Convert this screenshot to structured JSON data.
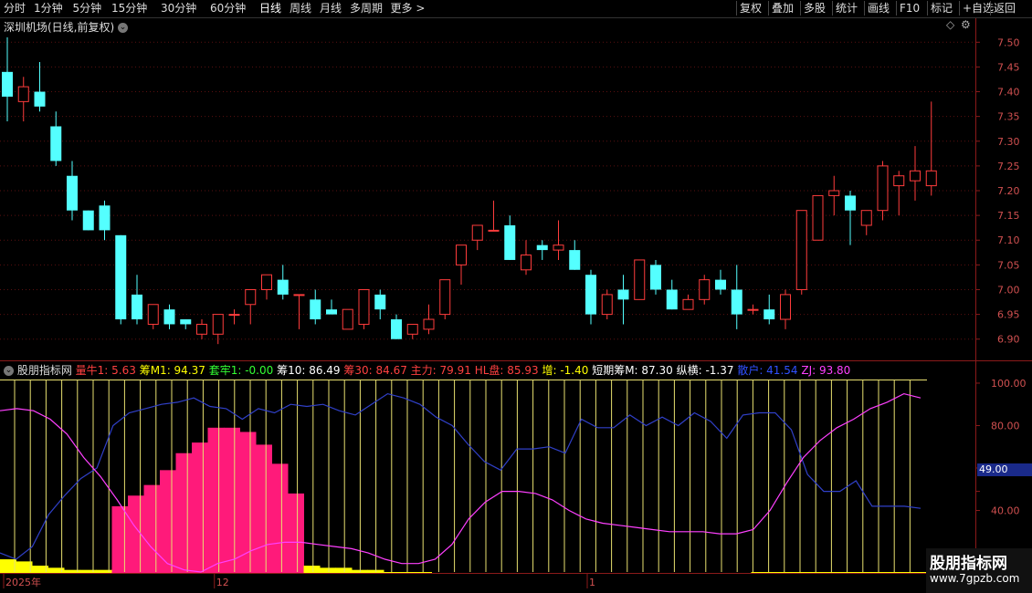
{
  "toolbar": {
    "left": [
      "分时",
      "1分钟",
      "5分钟",
      "15分钟",
      "30分钟",
      "60分钟",
      "日线",
      "周线",
      "月线",
      "多周期",
      "更多 >"
    ],
    "right": [
      "复权",
      "叠加",
      "多股",
      "统计",
      "画线",
      "F10",
      "标记",
      "+自选",
      "返回"
    ],
    "active": "日线"
  },
  "main_panel": {
    "title": "深圳机场(日线,前复权)",
    "up_color": "#ff3c3c",
    "down_color": "#54ffff"
  },
  "indicator_panel": {
    "name": "股朋指标网",
    "labels": [
      {
        "text": "量牛1: 5.63",
        "color": "#ff4040"
      },
      {
        "text": "筹M1: 94.37",
        "color": "#ffff00"
      },
      {
        "text": "套牢1: -0.00",
        "color": "#33ff33"
      },
      {
        "text": "筹10: 86.49",
        "color": "#ffffff"
      },
      {
        "text": "筹30: 84.67",
        "color": "#ff4040"
      },
      {
        "text": "主力: 79.91",
        "color": "#ff4040"
      },
      {
        "text": "HL盘: 85.93",
        "color": "#ff4040"
      },
      {
        "text": "增: -1.40",
        "color": "#ffff00"
      },
      {
        "text": "短期筹M: 87.30",
        "color": "#ffffff"
      },
      {
        "text": "纵横: -1.37",
        "color": "#ffffff"
      },
      {
        "text": "散户: 41.54",
        "color": "#3050ff"
      },
      {
        "text": "ZJ: 93.80",
        "color": "#ff40ff"
      }
    ],
    "badge": "49.00"
  },
  "x_axis": {
    "labels": [
      {
        "i": 0,
        "text": "2025年"
      },
      {
        "i": 13,
        "text": "12"
      },
      {
        "i": 36,
        "text": "1"
      }
    ]
  },
  "watermark": {
    "line1": "股朋指标网",
    "line2": "www.7gpzb.com"
  },
  "chart_data": [
    {
      "type": "candlestick",
      "title": "深圳机场(日线,前复权)",
      "ylim": [
        6.87,
        7.53
      ],
      "y_ticks": [
        "7.50",
        "7.45",
        "7.40",
        "7.35",
        "7.30",
        "7.25",
        "7.20",
        "7.15",
        "7.10",
        "7.05",
        "7.00",
        "6.95",
        "6.90"
      ],
      "ohlc": [
        [
          7.44,
          7.51,
          7.34,
          7.39
        ],
        [
          7.38,
          7.43,
          7.34,
          7.41
        ],
        [
          7.4,
          7.46,
          7.36,
          7.37
        ],
        [
          7.33,
          7.36,
          7.25,
          7.26
        ],
        [
          7.23,
          7.26,
          7.14,
          7.16
        ],
        [
          7.16,
          7.16,
          7.12,
          7.12
        ],
        [
          7.17,
          7.18,
          7.1,
          7.12
        ],
        [
          7.11,
          7.11,
          6.93,
          6.94
        ],
        [
          6.99,
          7.03,
          6.93,
          6.94
        ],
        [
          6.93,
          6.97,
          6.92,
          6.97
        ],
        [
          6.96,
          6.97,
          6.92,
          6.93
        ],
        [
          6.94,
          6.94,
          6.92,
          6.93
        ],
        [
          6.91,
          6.94,
          6.9,
          6.93
        ],
        [
          6.91,
          6.95,
          6.89,
          6.95
        ],
        [
          6.95,
          6.96,
          6.93,
          6.95
        ],
        [
          6.97,
          7.0,
          6.93,
          7.0
        ],
        [
          7.0,
          7.03,
          6.98,
          7.03
        ],
        [
          7.02,
          7.05,
          6.98,
          6.99
        ],
        [
          6.99,
          6.99,
          6.92,
          6.99
        ],
        [
          6.98,
          7.0,
          6.93,
          6.94
        ],
        [
          6.96,
          6.98,
          6.95,
          6.95
        ],
        [
          6.92,
          6.96,
          6.92,
          6.96
        ],
        [
          6.93,
          7.0,
          6.92,
          7.0
        ],
        [
          6.99,
          7.0,
          6.94,
          6.96
        ],
        [
          6.94,
          6.95,
          6.9,
          6.9
        ],
        [
          6.91,
          6.93,
          6.9,
          6.93
        ],
        [
          6.92,
          6.97,
          6.91,
          6.94
        ],
        [
          6.95,
          7.01,
          6.94,
          7.02
        ],
        [
          7.05,
          7.09,
          7.01,
          7.09
        ],
        [
          7.1,
          7.13,
          7.08,
          7.13
        ],
        [
          7.12,
          7.18,
          7.12,
          7.12
        ],
        [
          7.13,
          7.15,
          7.06,
          7.06
        ],
        [
          7.04,
          7.1,
          7.03,
          7.07
        ],
        [
          7.09,
          7.1,
          7.06,
          7.08
        ],
        [
          7.08,
          7.14,
          7.06,
          7.09
        ],
        [
          7.08,
          7.1,
          7.04,
          7.04
        ],
        [
          7.03,
          7.04,
          6.93,
          6.95
        ],
        [
          6.95,
          7.0,
          6.94,
          6.99
        ],
        [
          7.0,
          7.03,
          6.93,
          6.98
        ],
        [
          6.98,
          7.06,
          6.98,
          7.06
        ],
        [
          7.05,
          7.06,
          6.99,
          7.0
        ],
        [
          7.0,
          7.02,
          6.96,
          6.96
        ],
        [
          6.96,
          6.99,
          6.96,
          6.98
        ],
        [
          6.98,
          7.03,
          6.97,
          7.02
        ],
        [
          7.02,
          7.04,
          6.99,
          7.0
        ],
        [
          7.0,
          7.05,
          6.92,
          6.95
        ],
        [
          6.96,
          6.97,
          6.95,
          6.96
        ],
        [
          6.96,
          6.99,
          6.93,
          6.94
        ],
        [
          6.94,
          7.0,
          6.92,
          6.99
        ],
        [
          7.0,
          7.16,
          6.99,
          7.16
        ],
        [
          7.1,
          7.19,
          7.1,
          7.19
        ],
        [
          7.19,
          7.23,
          7.15,
          7.2
        ],
        [
          7.19,
          7.2,
          7.09,
          7.16
        ],
        [
          7.13,
          7.14,
          7.11,
          7.16
        ],
        [
          7.16,
          7.26,
          7.14,
          7.25
        ],
        [
          7.21,
          7.24,
          7.15,
          7.23
        ],
        [
          7.22,
          7.29,
          7.18,
          7.24
        ],
        [
          7.21,
          7.38,
          7.19,
          7.24
        ]
      ]
    },
    {
      "type": "line",
      "title": "股朋指标网",
      "ylim": [
        11,
        106
      ],
      "y_ticks": [
        100,
        80,
        60,
        49,
        40,
        20
      ],
      "series": [
        {
          "name": "散户",
          "values": [
            20,
            17,
            23,
            38,
            47,
            55,
            60,
            80,
            86,
            88,
            90,
            91,
            93,
            89,
            88,
            83,
            88,
            86,
            90,
            89,
            90,
            87,
            85,
            90,
            95,
            93,
            90,
            84,
            80,
            71,
            63,
            59,
            69,
            69,
            70,
            67,
            83,
            79,
            79,
            85,
            80,
            84,
            80,
            86,
            82,
            74,
            85,
            86,
            86,
            78,
            57,
            49,
            49,
            54,
            42,
            42,
            42,
            41
          ]
        },
        {
          "name": "ZJ",
          "values": [
            87,
            88,
            87,
            83,
            76,
            65,
            56,
            45,
            33,
            23,
            15,
            12,
            11,
            15,
            17,
            21,
            24,
            25,
            25,
            24,
            23,
            22,
            20,
            17,
            15,
            15,
            17,
            24,
            36,
            44,
            49,
            49,
            48,
            45,
            40,
            36,
            34,
            33,
            32,
            31,
            30,
            30,
            30,
            29,
            29,
            31,
            40,
            53,
            65,
            73,
            79,
            83,
            88,
            91,
            95,
            93
          ]
        },
        {
          "name": "量牛1",
          "values": [
            17,
            16,
            14,
            13,
            12,
            12,
            12,
            42,
            47,
            52,
            59,
            67,
            72,
            79,
            79,
            77,
            71,
            62,
            48,
            14,
            13,
            13,
            12,
            12,
            11,
            11,
            11,
            10,
            10,
            10,
            10,
            10,
            10,
            10,
            10,
            10,
            10,
            10,
            10,
            10,
            10,
            10,
            10,
            10,
            10,
            10,
            10,
            11,
            11,
            11,
            11,
            11,
            11,
            11,
            11,
            11,
            11,
            11
          ]
        }
      ]
    }
  ]
}
